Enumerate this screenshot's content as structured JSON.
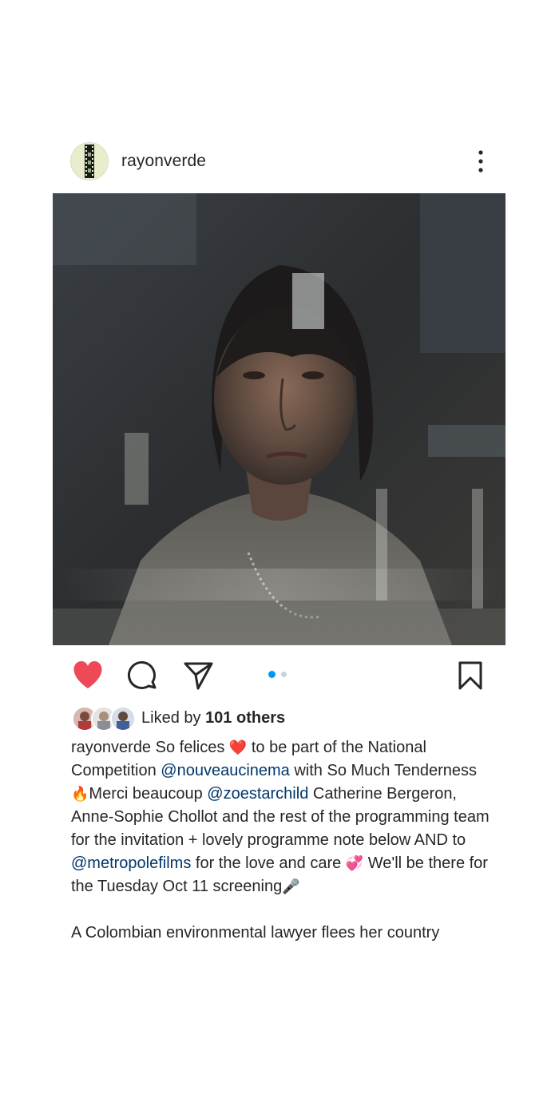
{
  "post": {
    "username": "rayonverde",
    "more_label": "More options",
    "media": {
      "carousel_total": 2,
      "carousel_active": 1
    },
    "colors": {
      "like_red": "#ed4956",
      "mention_blue": "#00376b",
      "dot_active": "#0095f6",
      "dot_inactive": "#c7d4dc"
    },
    "actions": {
      "like_icon": "heart-filled-icon",
      "comment_icon": "comment-bubble-icon",
      "share_icon": "paper-plane-icon",
      "save_icon": "bookmark-icon"
    },
    "likes": {
      "prefix": "Liked by",
      "count_text": "101 others"
    },
    "caption": {
      "username": "rayonverde",
      "t1": " So felices ",
      "e1": "❤️",
      "t2": " to be part of the National Competition ",
      "m1": "@nouveaucinema",
      "t3": " with So Much Tenderness ",
      "e2": "🔥",
      "t4": "Merci beaucoup ",
      "m2": "@zoestarchild",
      "t5": " Catherine Bergeron, Anne-Sophie Chollot and the rest of the programming team for the invitation + lovely programme note below AND to ",
      "m3": "@metropolefilms",
      "t6": " for the love and care ",
      "e3": "💞",
      "t7": " We'll be there for the Tuesday Oct 11 screening",
      "e4": "🎤",
      "p2": "A Colombian environmental lawyer flees her country"
    }
  }
}
